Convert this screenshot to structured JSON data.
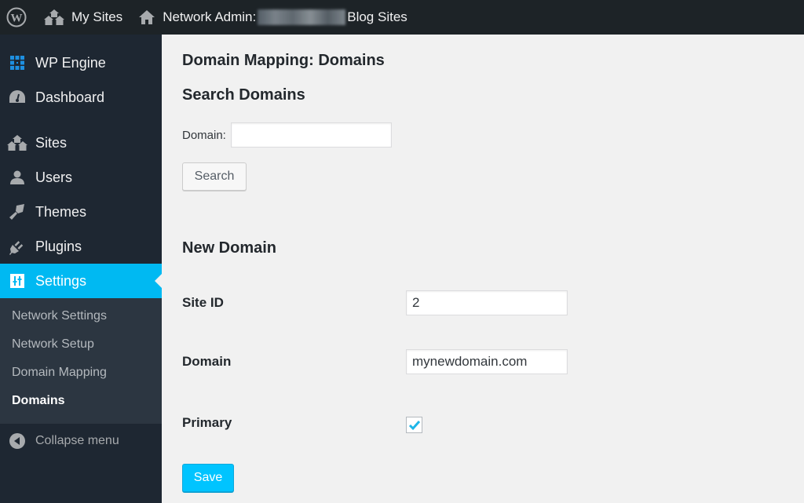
{
  "adminbar": {
    "my_sites_label": "My Sites",
    "network_admin_prefix": "Network Admin:",
    "network_admin_suffix": "Blog Sites"
  },
  "sidebar": {
    "items": [
      {
        "label": "WP Engine",
        "icon": "wp-engine-icon"
      },
      {
        "label": "Dashboard",
        "icon": "dashboard-icon"
      },
      {
        "label": "Sites",
        "icon": "sites-icon"
      },
      {
        "label": "Users",
        "icon": "users-icon"
      },
      {
        "label": "Themes",
        "icon": "themes-icon"
      },
      {
        "label": "Plugins",
        "icon": "plugins-icon"
      },
      {
        "label": "Settings",
        "icon": "settings-icon",
        "active": true
      }
    ],
    "submenu": [
      {
        "label": "Network Settings"
      },
      {
        "label": "Network Setup"
      },
      {
        "label": "Domain Mapping"
      },
      {
        "label": "Domains",
        "current": true
      }
    ],
    "collapse_label": "Collapse menu"
  },
  "main": {
    "page_title": "Domain Mapping: Domains",
    "search": {
      "heading": "Search Domains",
      "domain_label": "Domain:",
      "domain_value": "",
      "button_label": "Search"
    },
    "new_domain": {
      "heading": "New Domain",
      "site_id_label": "Site ID",
      "site_id_value": "2",
      "domain_label": "Domain",
      "domain_value": "mynewdomain.com",
      "primary_label": "Primary",
      "primary_checked": true,
      "save_label": "Save"
    }
  },
  "colors": {
    "accent": "#00b9f2",
    "sidebar_bg": "#1e2732",
    "adminbar_bg": "#1d2327",
    "save_button": "#00c4ff"
  }
}
